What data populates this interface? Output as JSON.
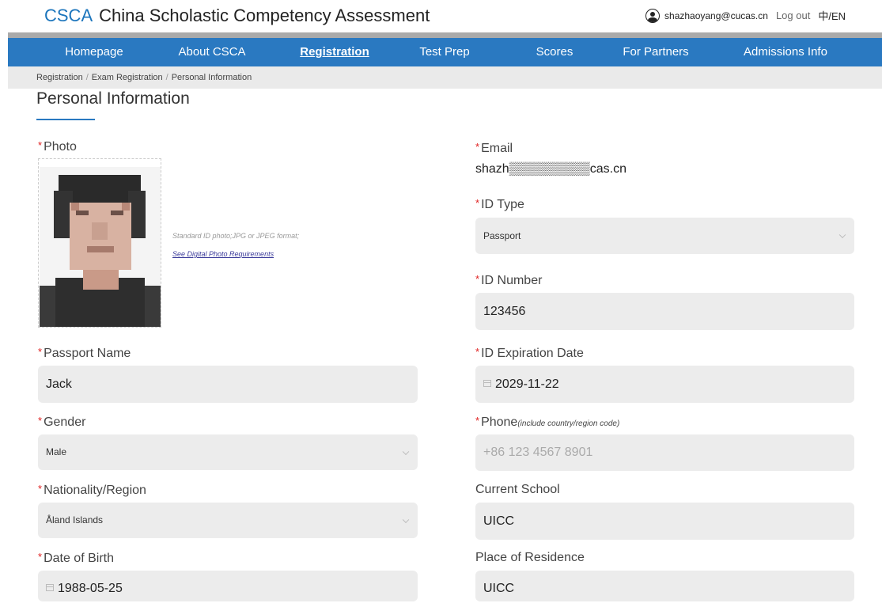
{
  "header": {
    "logo": "CSCA",
    "site_name": "China Scholastic Competency Assessment",
    "user_email": "shazhaoyang@cucas.cn",
    "logout": "Log out",
    "language": "中/EN"
  },
  "nav": {
    "items": [
      {
        "label": "Homepage"
      },
      {
        "label": "About CSCA"
      },
      {
        "label": "Registration",
        "active": true
      },
      {
        "label": "Test Prep"
      },
      {
        "label": "Scores"
      },
      {
        "label": "For Partners"
      },
      {
        "label": "Admissions Info"
      }
    ]
  },
  "breadcrumb": [
    "Registration",
    "Exam Registration",
    "Personal Information"
  ],
  "breadcrumb_sep": "/",
  "page_title": "Personal Information",
  "required_mark": "*",
  "form": {
    "photo": {
      "label": "Photo",
      "hint": "Standard ID photo;JPG or JPEG format;",
      "link": "See Digital Photo Requirements"
    },
    "email": {
      "label": "Email",
      "value": "shazh▒▒▒▒▒▒▒▒▒cas.cn"
    },
    "id_type": {
      "label": "ID Type",
      "value": "Passport"
    },
    "id_number": {
      "label": "ID Number",
      "value": "123456"
    },
    "passport_name": {
      "label": "Passport Name",
      "value": "Jack"
    },
    "id_expiration": {
      "label": "ID Expiration Date",
      "value": "2029-11-22"
    },
    "gender": {
      "label": "Gender",
      "value": "Male"
    },
    "phone": {
      "label": "Phone",
      "hint": "(include country/region code)",
      "placeholder": "+86 123 4567 8901"
    },
    "nationality": {
      "label": "Nationality/Region",
      "value": "Åland Islands"
    },
    "current_school": {
      "label": "Current School",
      "value": "UICC"
    },
    "dob": {
      "label": "Date of Birth",
      "value": "1988-05-25"
    },
    "residence": {
      "label": "Place of Residence",
      "value": "UICC"
    }
  },
  "colors": {
    "brand_blue": "#2a79c1",
    "required_red": "#e02020",
    "field_bg": "#ececec"
  }
}
